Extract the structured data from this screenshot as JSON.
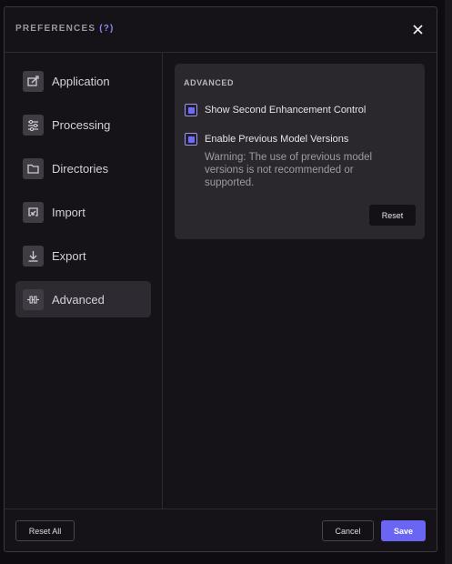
{
  "dialog": {
    "title": "PREFERENCES",
    "help": "(?)"
  },
  "sidebar": {
    "items": [
      {
        "label": "Application",
        "icon": "application-icon"
      },
      {
        "label": "Processing",
        "icon": "sliders-icon"
      },
      {
        "label": "Directories",
        "icon": "folder-icon"
      },
      {
        "label": "Import",
        "icon": "import-icon"
      },
      {
        "label": "Export",
        "icon": "download-icon"
      },
      {
        "label": "Advanced",
        "icon": "advanced-icon",
        "active": true
      }
    ]
  },
  "advanced": {
    "heading": "ADVANCED",
    "options": [
      {
        "label": "Show Second Enhancement Control",
        "checked": true
      },
      {
        "label": "Enable Previous Model Versions",
        "checked": true
      }
    ],
    "warning": "Warning: The use of previous model versions is not recommended or supported.",
    "reset_label": "Reset"
  },
  "footer": {
    "reset_all_label": "Reset All",
    "cancel_label": "Cancel",
    "save_label": "Save"
  },
  "colors": {
    "accent": "#6a66f3",
    "background": "#151218",
    "panel": "#2a272d"
  }
}
